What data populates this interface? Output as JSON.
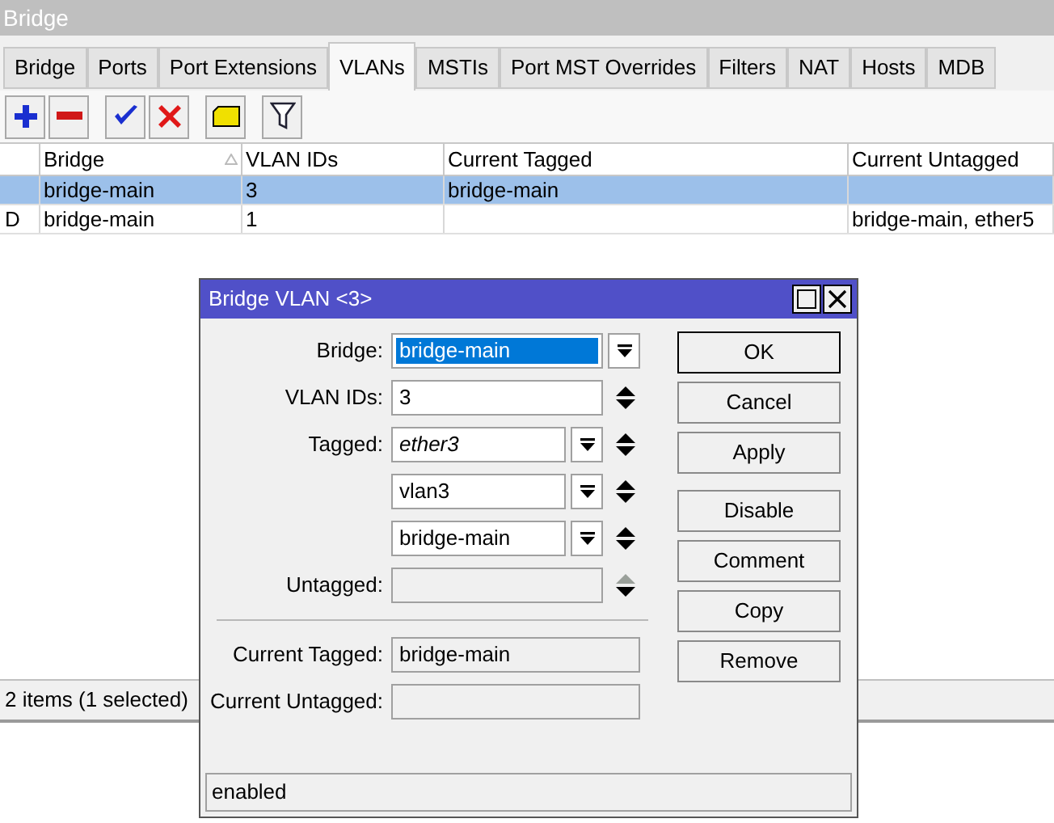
{
  "window": {
    "title": "Bridge"
  },
  "tabs": [
    {
      "label": "Bridge",
      "selected": false
    },
    {
      "label": "Ports",
      "selected": false
    },
    {
      "label": "Port Extensions",
      "selected": false
    },
    {
      "label": "VLANs",
      "selected": true
    },
    {
      "label": "MSTIs",
      "selected": false
    },
    {
      "label": "Port MST Overrides",
      "selected": false
    },
    {
      "label": "Filters",
      "selected": false
    },
    {
      "label": "NAT",
      "selected": false
    },
    {
      "label": "Hosts",
      "selected": false
    },
    {
      "label": "MDB",
      "selected": false
    }
  ],
  "toolbar": [
    {
      "kind": "add"
    },
    {
      "kind": "remove"
    },
    {
      "kind": "enable"
    },
    {
      "kind": "disable"
    },
    {
      "kind": "comment"
    },
    {
      "kind": "filter"
    }
  ],
  "table": {
    "columns": [
      "Bridge",
      "VLAN IDs",
      "Current Tagged",
      "Current Untagged"
    ],
    "rows": [
      {
        "flag": "",
        "cells": [
          "bridge-main",
          "3",
          "bridge-main",
          ""
        ],
        "selected": true
      },
      {
        "flag": "D",
        "cells": [
          "bridge-main",
          "1",
          "",
          "bridge-main, ether5"
        ],
        "selected": false
      }
    ]
  },
  "status_bar": "2 items (1 selected)",
  "dialog": {
    "title": "Bridge VLAN <3>",
    "rows": [
      {
        "kind": "combo",
        "label": "Bridge:",
        "value": "bridge-main",
        "selected": true
      },
      {
        "kind": "spin",
        "label": "VLAN IDs:",
        "value": "3",
        "disabled": false
      },
      {
        "kind": "multi",
        "label": "Tagged:",
        "value": "ether3",
        "invalid": true
      },
      {
        "kind": "multi",
        "value": "vlan3",
        "invalid": false
      },
      {
        "kind": "multi",
        "value": "bridge-main",
        "invalid": false
      },
      {
        "kind": "spin",
        "label": "Untagged:",
        "disabled": true
      },
      {
        "kind": "separator"
      },
      {
        "kind": "readonly",
        "label": "Current Tagged:",
        "value": "bridge-main"
      },
      {
        "kind": "readonly",
        "label": "Current Untagged:"
      }
    ],
    "buttons": [
      {
        "label": "OK",
        "default": true
      },
      {
        "label": "Cancel",
        "default": false
      },
      {
        "label": "Apply",
        "default": false
      },
      {
        "label": "Disable",
        "default": false,
        "gap": true
      },
      {
        "label": "Comment",
        "default": false
      },
      {
        "label": "Copy",
        "default": false
      },
      {
        "label": "Remove",
        "default": false
      }
    ],
    "status": "enabled"
  }
}
